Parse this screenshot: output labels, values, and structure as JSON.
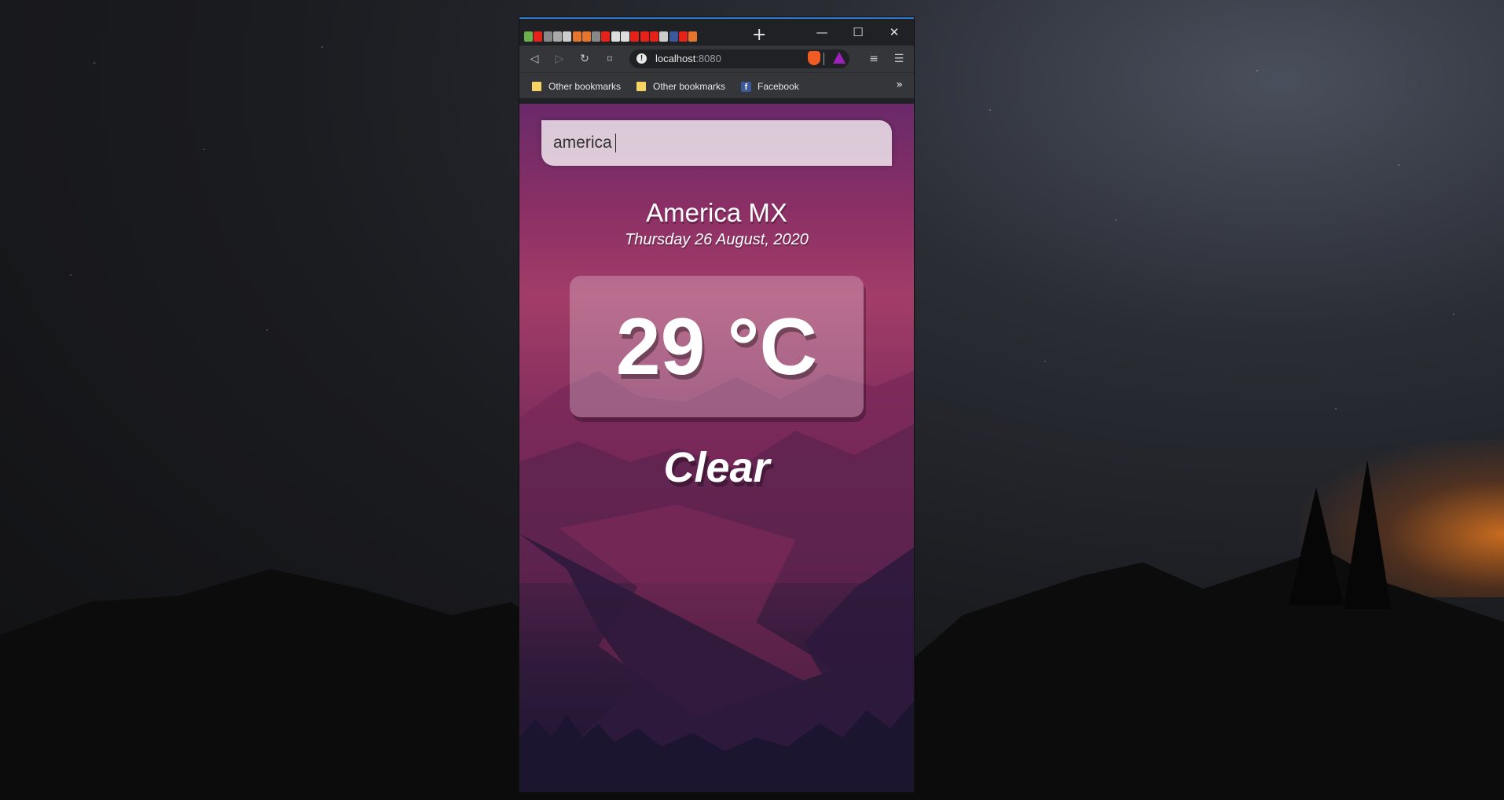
{
  "browser": {
    "tabs": {
      "favicon_colors": [
        "#6ab04c",
        "#e62117",
        "#888888",
        "#aaaaaa",
        "#cccccc",
        "#e6762e",
        "#e6762e",
        "#888888",
        "#e62117",
        "#dddddd",
        "#dddddd",
        "#e62117",
        "#e62117",
        "#e62117",
        "#cccccc",
        "#3b5998",
        "#e62117",
        "#e6762e"
      ],
      "new_tab_icon": "plus-icon"
    },
    "window_controls": {
      "minimize": "—",
      "maximize": "☐",
      "close": "✕"
    },
    "toolbar": {
      "back_icon": "◁",
      "forward_icon": "▷",
      "reload_icon": "↻",
      "bookmark_icon": "🔖",
      "url_host": "localhost",
      "url_port": ":8080",
      "info_icon": "!",
      "zoom_icon": "⊕",
      "media_icon": "≡",
      "menu_icon": "☰"
    },
    "bookmarks": [
      {
        "label": "Other bookmarks",
        "icon": "folder-icon"
      },
      {
        "label": "Other bookmarks",
        "icon": "folder-icon"
      },
      {
        "label": "Facebook",
        "icon": "facebook-icon",
        "glyph": "f"
      }
    ],
    "bookmarks_overflow": "»"
  },
  "app": {
    "search": {
      "value": "america",
      "placeholder": ""
    },
    "location": "America MX",
    "date": "Thursday 26 August, 2020",
    "temperature": "29 °C",
    "weather": "Clear"
  }
}
